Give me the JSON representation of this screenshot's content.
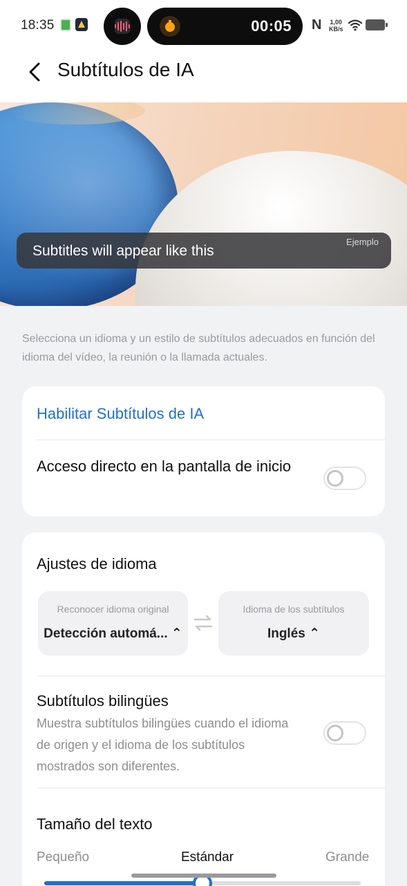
{
  "status_bar": {
    "time": "18:35",
    "timer": "00:05",
    "network_label": "N",
    "speed_value": "1,00",
    "speed_unit": "KB/s"
  },
  "header": {
    "title": "Subtítulos de IA"
  },
  "preview": {
    "caption_text": "Subtitles will appear like this",
    "tag": "Ejemplo"
  },
  "description": "Selecciona un idioma y un estilo de subtítulos adecuados en función del idioma del vídeo, la reunión o la llamada actuales.",
  "card1": {
    "enable_label": "Habilitar Subtítulos de IA",
    "shortcut_label": "Acceso directo en la pantalla de inicio",
    "shortcut_on": false
  },
  "language_settings": {
    "heading": "Ajustes de idioma",
    "source_caption": "Reconocer idioma original",
    "source_value": "Detección automá... ⌃",
    "target_caption": "Idioma de los subtítulos",
    "target_value": "Inglés ⌃"
  },
  "bilingual": {
    "label": "Subtítulos bilingües",
    "description": "Muestra subtítulos bilingües cuando el idioma de origen y el idioma de los subtítulos mostrados son diferentes.",
    "on": false
  },
  "text_size": {
    "heading": "Tamaño del texto",
    "small": "Pequeño",
    "standard": "Estándar",
    "large": "Grande",
    "value": 0.5
  },
  "colors": {
    "accent": "#1f6fd6",
    "background": "#f1f2f4"
  }
}
